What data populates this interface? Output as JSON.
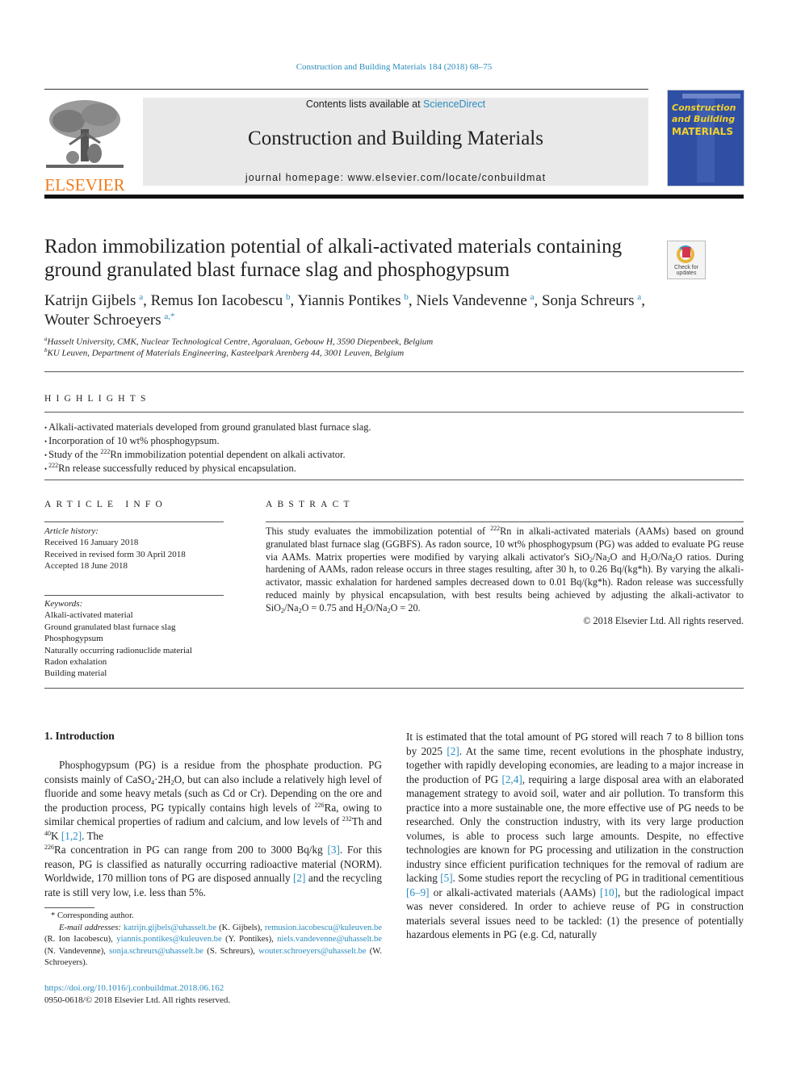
{
  "header": {
    "journal_ref": "Construction and Building Materials 184 (2018) 68–75",
    "contents_prefix": "Contents lists available at ",
    "contents_link": "ScienceDirect",
    "journal_title": "Construction and Building Materials",
    "homepage_prefix": "journal homepage: ",
    "homepage_url": "www.elsevier.com/locate/conbuildmat",
    "publisher_logo_text": "ELSEVIER",
    "cover": {
      "line1": "Construction",
      "line2": "and Building",
      "line3": "MATERIALS"
    },
    "colors": {
      "link": "#2a8cbf",
      "elsevier_orange": "#f07c1b",
      "cover_blue": "#2f4fa5",
      "cover_yellow": "#f2d129"
    }
  },
  "article": {
    "title_line1": "Radon immobilization potential of alkali-activated materials containing",
    "title_line2": "ground granulated blast furnace slag and phosphogypsum",
    "crossmark_line1": "Check for",
    "crossmark_line2": "updates",
    "authors": [
      {
        "name": "Katrijn Gijbels",
        "aff": "a",
        "sep": ", "
      },
      {
        "name": "Remus Ion Iacobescu",
        "aff": "b",
        "sep": ", "
      },
      {
        "name": "Yiannis Pontikes",
        "aff": "b",
        "sep": ", "
      },
      {
        "name": "Niels Vandevenne",
        "aff": "a",
        "sep": ", "
      },
      {
        "name": "Sonja Schreurs",
        "aff": "a",
        "sep": ","
      },
      {
        "name": "Wouter Schroeyers",
        "aff": "a,*",
        "sep": ""
      }
    ],
    "affiliations": [
      {
        "mark": "a",
        "text": "Hasselt University, CMK, Nuclear Technological Centre, Agoralaan, Gebouw H, 3590 Diepenbeek, Belgium"
      },
      {
        "mark": "b",
        "text": "KU Leuven, Department of Materials Engineering, Kasteelpark Arenberg 44, 3001 Leuven, Belgium"
      }
    ]
  },
  "highlights": {
    "heading": "HIGHLIGHTS",
    "items": [
      {
        "pre": "Alkali-activated materials developed from ground granulated blast furnace slag.",
        "sup": "",
        "post": ""
      },
      {
        "pre": "Incorporation of 10 wt% phosphogypsum.",
        "sup": "",
        "post": ""
      },
      {
        "pre": "Study of the ",
        "sup": "222",
        "post": "Rn immobilization potential dependent on alkali activator."
      },
      {
        "pre": "",
        "sup": "222",
        "post": "Rn release successfully reduced by physical encapsulation."
      }
    ]
  },
  "article_info": {
    "heading": "ARTICLE INFO",
    "history_label": "Article history:",
    "history": [
      "Received 16 January 2018",
      "Received in revised form 30 April 2018",
      "Accepted 18 June 2018"
    ],
    "keywords_label": "Keywords:",
    "keywords": [
      "Alkali-activated material",
      "Ground granulated blast furnace slag",
      "Phosphogypsum",
      "Naturally occurring radionuclide material",
      "Radon exhalation",
      "Building material"
    ]
  },
  "abstract": {
    "heading": "ABSTRACT",
    "p1": "This study evaluates the immobilization potential of ",
    "sup1": "222",
    "p2": "Rn in alkali-activated materials (AAMs) based on ground granulated blast furnace slag (GGBFS). As radon source, 10 wt% phosphogypsum (PG) was added to evaluate PG reuse via AAMs. Matrix properties were modified by varying alkali activator's SiO",
    "p3": "/Na",
    "p4": "O and H",
    "p5": "O/Na",
    "p6": "O ratios. During hardening of AAMs, radon release occurs in three stages resulting, after 30 h, to 0.26 Bq/(kg*h). By varying the alkali-activator, massic exhalation for hardened samples decreased down to 0.01 Bq/(kg*h). Radon release was successfully reduced mainly by physical encapsulation, with best results being achieved by adjusting the alkali-activator to SiO",
    "p7": "/Na",
    "p8": "O = 0.75 and H",
    "p9": "O/Na",
    "p10": "O = 20.",
    "sub2": "2",
    "copyright": "© 2018 Elsevier Ltd. All rights reserved."
  },
  "intro": {
    "heading": "1. Introduction",
    "left": {
      "t1": "Phosphogypsum (PG) is a residue from the phosphate production. PG consists mainly of CaSO",
      "sub4": "4",
      "t2": "·2H",
      "t3": "O, but can also include a relatively high level of fluoride and some heavy metals (such as Cd or Cr). Depending on the ore and the production process, PG typically contains high levels of ",
      "sup226": "226",
      "t4": "Ra, owing to similar chemical properties of radium and calcium, and low levels of ",
      "sup232": "232",
      "t5": "Th and ",
      "sup40": "40",
      "t6": "K ",
      "ref12": "[1,2]",
      "t7": ". The ",
      "t8": "Ra concentration in PG can range from 200 to 3000 Bq/kg ",
      "ref3": "[3]",
      "t9": ". For this reason, PG is classified as naturally occurring radioactive material (NORM). Worldwide, 170 million tons of PG are disposed annually ",
      "ref2": "[2]",
      "t10": " and the recycling rate is still very low, i.e. less than 5%."
    },
    "right": {
      "t1": "It is estimated that the total amount of PG stored will reach 7 to 8 billion tons by 2025 ",
      "ref2": "[2]",
      "t2": ". At the same time, recent evolutions in the phosphate industry, together with rapidly developing economies, are leading to a major increase in the production of PG ",
      "ref24": "[2,4]",
      "t3": ", requiring a large disposal area with an elaborated management strategy to avoid soil, water and air pollution. To transform this practice into a more sustainable one, the more effective use of PG needs to be researched. Only the construction industry, with its very large production volumes, is able to process such large amounts. Despite, no effective technologies are known for PG processing and utilization in the construction industry since efficient purification techniques for the removal of radium are lacking ",
      "ref5": "[5]",
      "t4": ". Some studies report the recycling of PG in traditional cementitious ",
      "ref69": "[6–9]",
      "t5": " or alkali-activated materials (AAMs) ",
      "ref10": "[10]",
      "t6": ", but the radiological impact was never considered. In order to achieve reuse of PG in construction materials several issues need to be tackled: (1) the presence of potentially hazardous elements in PG (e.g. Cd, naturally"
    }
  },
  "footnotes": {
    "corresponding": "* Corresponding author.",
    "email_label": "E-mail addresses: ",
    "emails": [
      {
        "addr": "katrijn.gijbels@uhasselt.be",
        "who": " (K. Gijbels), "
      },
      {
        "addr": "remusion.iacobescu@kuleuven.be",
        "who": " (R. Ion Iacobescu), "
      },
      {
        "addr": "yiannis.pontikes@kuleuven.be",
        "who": " (Y. Pontikes), "
      },
      {
        "addr": "niels.vandevenne@uhasselt.be",
        "who": " (N. Vandevenne), "
      },
      {
        "addr": "sonja.schreurs@uhasselt.be",
        "who": " (S. Schreurs), "
      },
      {
        "addr": "wouter.schroeyers@uhasselt.be",
        "who": " (W. Schroeyers)."
      }
    ],
    "doi": "https://doi.org/10.1016/j.conbuildmat.2018.06.162",
    "issn_line": "0950-0618/© 2018 Elsevier Ltd. All rights reserved."
  }
}
